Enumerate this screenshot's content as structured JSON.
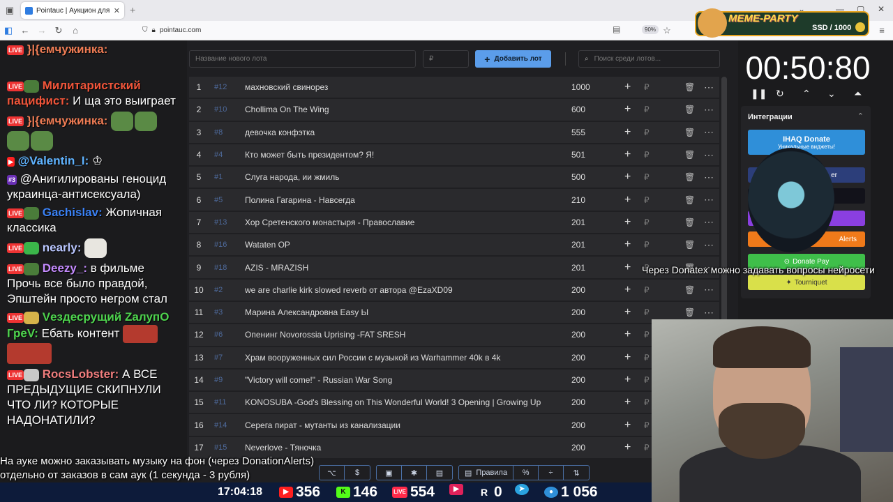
{
  "browser": {
    "tab_title": "Pointauc | Аукцион для стримера",
    "tab_close": "✕",
    "new_tab": "+",
    "url": "pointauc.com",
    "zoom": "90%"
  },
  "meme_banner": {
    "name": "MEME-PARTY",
    "counter": "SSD / 1000"
  },
  "chat": {
    "messages": [
      {
        "user": "}|{емчужинка:",
        "text": ""
      },
      {
        "user": "Милитаристский пацифист:",
        "text": "И ща это выиграет"
      },
      {
        "user": "}|{емчужинка:",
        "text": ""
      },
      {
        "user": "@Valentin_I:",
        "text": ""
      },
      {
        "badge": "#3",
        "user": "",
        "text": "@Анигилированы геноцид украинца-антисексуала)"
      },
      {
        "user": "Gachislav:",
        "text": "Жопичная классика"
      },
      {
        "user": "nearly:",
        "text": ""
      },
      {
        "user": "Deezy_:",
        "text": "в фильме Прочь все было правдой, Эпштейн просто негром стал"
      },
      {
        "user": "Vездесрущий ZалупО ГреV:",
        "text": "Ебать контент"
      },
      {
        "user": "RocsLobster:",
        "text": "А ВСЕ ПРЕДЫДУЩИЕ СКИПНУЛИ ЧТО ЛИ? КОТОРЫЕ НАДОНАТИЛИ?"
      }
    ]
  },
  "auction": {
    "new_lot_placeholder": "Название нового лота",
    "amount_placeholder": "₽",
    "add_button": "Добавить лот",
    "search_placeholder": "Поиск среди лотов...",
    "lots": [
      {
        "n": "1",
        "id": "#12",
        "name": "махновский свинорез",
        "amount": "1000"
      },
      {
        "n": "2",
        "id": "#10",
        "name": "Chollima On The Wing",
        "amount": "600"
      },
      {
        "n": "3",
        "id": "#8",
        "name": "девочка конфэтка",
        "amount": "555"
      },
      {
        "n": "4",
        "id": "#4",
        "name": "Кто может быть президентом? Я!",
        "amount": "501"
      },
      {
        "n": "5",
        "id": "#1",
        "name": "Слуга народа, ии жмиль",
        "amount": "500"
      },
      {
        "n": "6",
        "id": "#5",
        "name": "Полина Гагарина - Навсегда",
        "amount": "210"
      },
      {
        "n": "7",
        "id": "#13",
        "name": "Хор Сретенского монастыря - Православие",
        "amount": "201"
      },
      {
        "n": "8",
        "id": "#16",
        "name": "Wataten OP",
        "amount": "201"
      },
      {
        "n": "9",
        "id": "#18",
        "name": "AZIS - MRAZISH",
        "amount": "201"
      },
      {
        "n": "10",
        "id": "#2",
        "name": "we are charlie kirk slowed reverb от автора @EzaXD09",
        "amount": "200"
      },
      {
        "n": "11",
        "id": "#3",
        "name": "Марина Александровна Easy Ы",
        "amount": "200"
      },
      {
        "n": "12",
        "id": "#6",
        "name": "Опенинг Novorossia Uprising -FAT SRESH",
        "amount": "200"
      },
      {
        "n": "13",
        "id": "#7",
        "name": "Храм вооруженных сил России с музыкой из Warhammer 40k в 4k",
        "amount": "200"
      },
      {
        "n": "14",
        "id": "#9",
        "name": "\"Victory will come!\" - Russian War Song",
        "amount": "200"
      },
      {
        "n": "15",
        "id": "#11",
        "name": "KONOSUBA -God's Blessing on This Wonderful World! 3 Opening | Growing Up",
        "amount": "200"
      },
      {
        "n": "16",
        "id": "#14",
        "name": "Серега пират - мутанты из канализации",
        "amount": "200"
      },
      {
        "n": "17",
        "id": "#15",
        "name": "Neverlove - Тяночка",
        "amount": "200"
      }
    ],
    "currency": "₽"
  },
  "timer": {
    "value": "00:50:80"
  },
  "integrations": {
    "title": "Интеграции",
    "buttons": [
      {
        "label": "IHAQ Donate",
        "color": "#2f8fd9"
      },
      {
        "label": "er",
        "color": "#2c3e7a"
      },
      {
        "label": "",
        "color": "#12121a"
      },
      {
        "label": "",
        "color": "#8a3fe0"
      },
      {
        "label": "Alerts",
        "color": "#f07a1a"
      },
      {
        "label": "Donate Pay",
        "color": "#3fbf4a"
      },
      {
        "label": "Tourniquet",
        "color": "#d9e04a"
      }
    ],
    "donate_subtext": "Уникальные виджеты!"
  },
  "overlay": {
    "float_text": "Через Donatex можно задавать вопросы нейросети",
    "subtitle_line1": "На ауке можно заказывать музыку на фон (через DonationAlerts)",
    "subtitle_line2": "отдельно от заказов в сам аук (1 секунда - 3 рубля)"
  },
  "toolbar": {
    "group1": [
      "⌥",
      "$"
    ],
    "group2": [
      "▣",
      "✱",
      "▤"
    ],
    "rules_label": "Правила",
    "group3": [
      "%",
      "÷",
      "⇅"
    ]
  },
  "stats": {
    "time": "17:04:18",
    "youtube": "356",
    "kick": "146",
    "vklive": "554",
    "rutube": "0",
    "telegram": "",
    "viewers": "1 056"
  }
}
